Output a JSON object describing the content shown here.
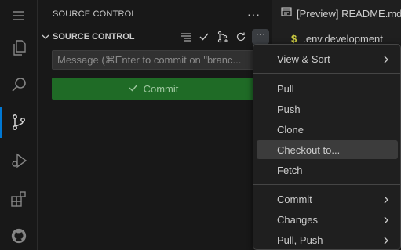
{
  "sidebar": {
    "title": "SOURCE CONTROL",
    "more": "···",
    "section_title": "SOURCE CONTROL",
    "section_more": "···",
    "message_placeholder": "Message (⌘Enter to commit on \"branc...",
    "commit_label": "Commit"
  },
  "editor": {
    "tab_label": "[Preview] README.md",
    "file_glyph": "$",
    "file_name": ".env.development"
  },
  "menu": {
    "items": [
      {
        "label": "View & Sort"
      },
      {
        "label": "Pull"
      },
      {
        "label": "Push"
      },
      {
        "label": "Clone"
      },
      {
        "label": "Checkout to..."
      },
      {
        "label": "Fetch"
      },
      {
        "label": "Commit"
      },
      {
        "label": "Changes"
      },
      {
        "label": "Pull, Push"
      }
    ]
  },
  "colors": {
    "accent": "#0078d4",
    "commit_button": "#1f6b26",
    "menu_hover": "#3c3c3c"
  },
  "icons": [
    "menu-icon",
    "files-icon",
    "search-icon",
    "source-control-icon",
    "run-debug-icon",
    "extensions-icon",
    "github-icon"
  ]
}
